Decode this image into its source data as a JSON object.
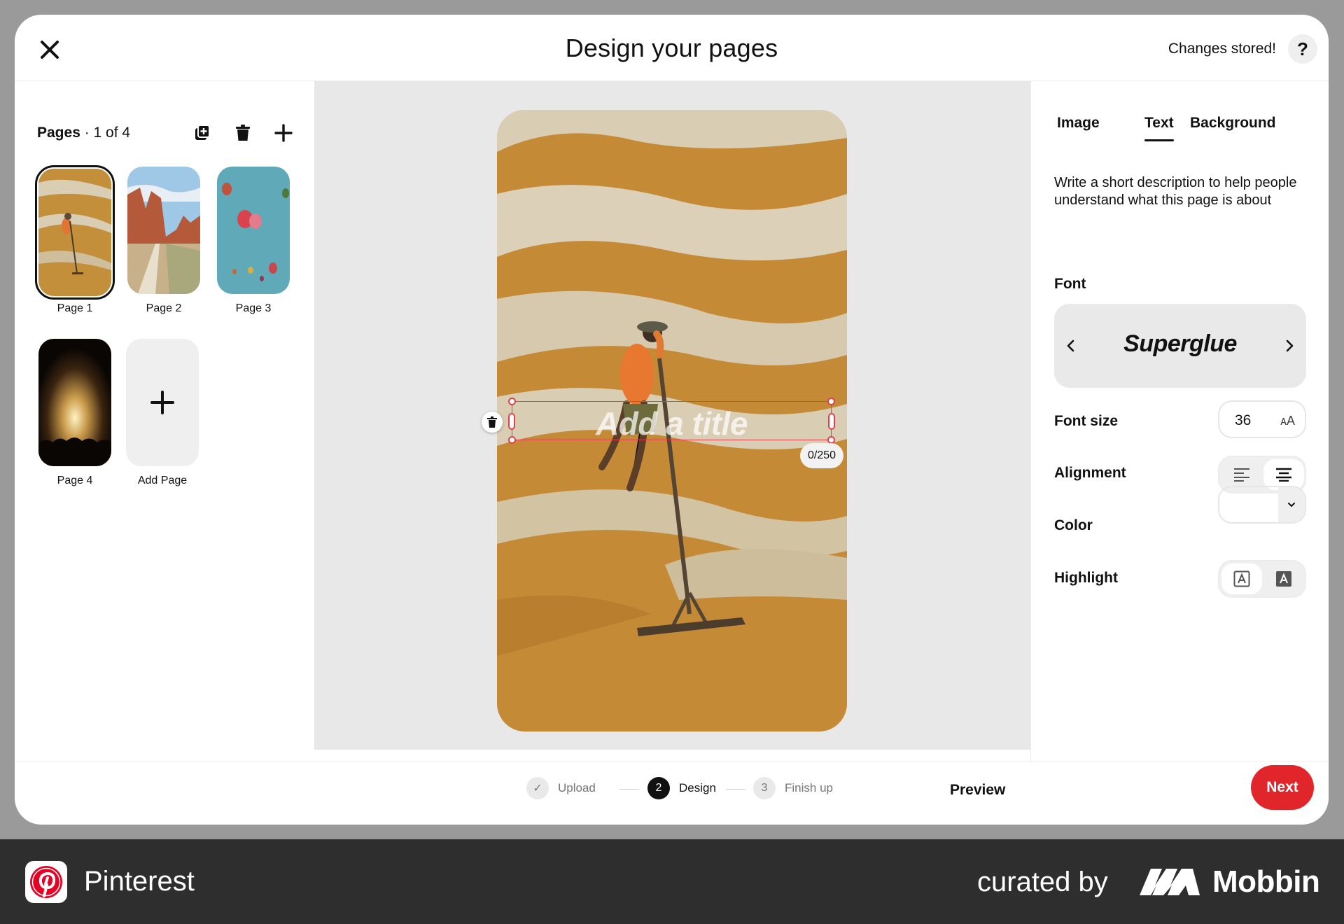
{
  "header": {
    "title": "Design your pages",
    "status": "Changes stored!",
    "help_label": "?"
  },
  "pages_panel": {
    "label": "Pages",
    "counter": "· 1 of 4",
    "pages": [
      {
        "label": "Page 1",
        "selected": true
      },
      {
        "label": "Page 2",
        "selected": false
      },
      {
        "label": "Page 3",
        "selected": false
      },
      {
        "label": "Page 4",
        "selected": false
      }
    ],
    "add_page_label": "Add Page"
  },
  "canvas": {
    "title_placeholder": "Add a title",
    "char_count": "0/250"
  },
  "text_panel": {
    "tabs": [
      {
        "label": "Image",
        "active": false
      },
      {
        "label": "Text",
        "active": true
      },
      {
        "label": "Background",
        "active": false
      }
    ],
    "description": "Write a short description to help people understand what this page is about",
    "font_label": "Font",
    "font_name": "Superglue",
    "font_size_label": "Font size",
    "font_size_value": "36",
    "font_size_icon": "ᴀA",
    "alignment_label": "Alignment",
    "alignment_selected": "center",
    "color_label": "Color",
    "color_value": "#ffffff",
    "highlight_label": "Highlight",
    "highlight_selected": "filled"
  },
  "footer": {
    "steps": [
      {
        "number": "✓",
        "label": "Upload",
        "state": "done"
      },
      {
        "number": "2",
        "label": "Design",
        "state": "current"
      },
      {
        "number": "3",
        "label": "Finish up",
        "state": "upcoming"
      }
    ],
    "preview_label": "Preview",
    "next_label": "Next"
  },
  "brand": {
    "app_name": "Pinterest",
    "curated_by": "curated by",
    "curator": "Mobbin"
  },
  "colors": {
    "accent": "#e0262b",
    "selection": "#e0404a",
    "canvas_bg": "#e8e8e8"
  }
}
